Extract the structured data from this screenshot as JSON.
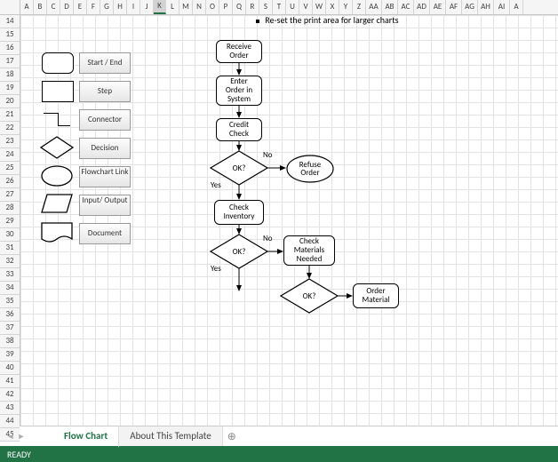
{
  "columns": [
    "A",
    "B",
    "C",
    "D",
    "E",
    "F",
    "G",
    "H",
    "I",
    "J",
    "K",
    "L",
    "M",
    "N",
    "O",
    "P",
    "Q",
    "R",
    "S",
    "T",
    "U",
    "V",
    "W",
    "X",
    "Y",
    "Z",
    "AA",
    "AB",
    "AC",
    "AD",
    "AE",
    "AF",
    "AG",
    "AH",
    "AI",
    "A"
  ],
  "selected_column": "K",
  "row_start": 14,
  "row_end": 45,
  "note": "Re-set the print area for larger charts",
  "legend": [
    {
      "label": "Start / End"
    },
    {
      "label": "Step"
    },
    {
      "label": "Connector"
    },
    {
      "label": "Decision"
    },
    {
      "label": "Flowchart Link"
    },
    {
      "label": "Input/ Output"
    },
    {
      "label": "Document"
    }
  ],
  "flow": {
    "n1": "Receive\nOrder",
    "n2": "Enter\nOrder in\nSystem",
    "n3": "Credit\nCheck",
    "d1": "OK?",
    "r1": "Refuse\nOrder",
    "n4": "Check\nInventory",
    "d2": "OK?",
    "r2": "Check\nMaterials\nNeeded",
    "d3": "OK?",
    "r3": "Order\nMaterial",
    "yes": "Yes",
    "no": "No"
  },
  "tabs": {
    "active": "Flow Chart",
    "other": "About This Template"
  },
  "status": "READY"
}
